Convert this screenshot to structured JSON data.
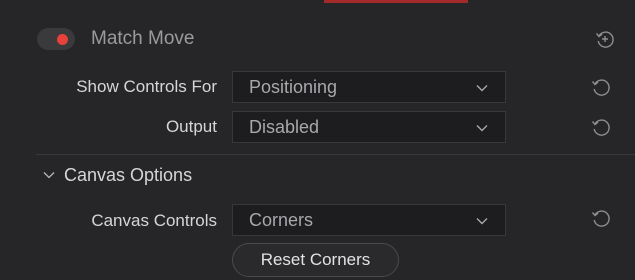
{
  "header": {
    "toggle_state": "on",
    "toggle_color": "#e8403b",
    "title": "Match Move",
    "reset_icon": "reset-plus-icon"
  },
  "controls": {
    "show_controls_for": {
      "label": "Show Controls For",
      "value": "Positioning",
      "reset_icon": "reset-icon"
    },
    "output": {
      "label": "Output",
      "value": "Disabled",
      "reset_icon": "reset-icon"
    }
  },
  "canvas_options": {
    "section_title": "Canvas Options",
    "expanded": true,
    "canvas_controls": {
      "label": "Canvas Controls",
      "value": "Corners",
      "reset_icon": "reset-icon"
    },
    "reset_button_label": "Reset Corners"
  },
  "colors": {
    "accent_bar": "#a32a2a",
    "panel_bg": "#262628"
  }
}
